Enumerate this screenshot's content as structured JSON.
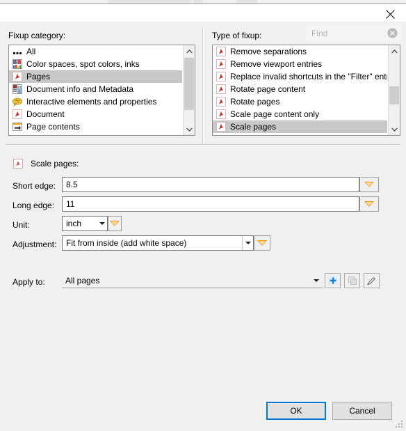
{
  "window": {
    "close_icon": "close-icon"
  },
  "left_pane": {
    "label": "Fixup category:",
    "items": [
      {
        "label": "All",
        "icon": "dots-icon",
        "selected": false
      },
      {
        "label": "Color spaces, spot colors, inks",
        "icon": "color-swatch-icon",
        "selected": false
      },
      {
        "label": "Pages",
        "icon": "pdf-icon",
        "selected": true
      },
      {
        "label": "Document info and Metadata",
        "icon": "metadata-info-icon",
        "selected": false
      },
      {
        "label": "Interactive elements and properties",
        "icon": "comment-bubble-icon",
        "selected": false
      },
      {
        "label": "Document",
        "icon": "pdf-icon",
        "selected": false
      },
      {
        "label": "Page contents",
        "icon": "arrow-page-icon",
        "selected": false
      }
    ],
    "scrollbar": {
      "up_icon": "chevron-up-icon",
      "down_icon": "chevron-down-icon"
    }
  },
  "right_pane": {
    "label": "Type of fixup:",
    "search": {
      "placeholder": "Find",
      "value": "",
      "clear_icon": "clear-circle-icon"
    },
    "items": [
      {
        "label": "Remove separations",
        "icon": "pdf-icon",
        "selected": false
      },
      {
        "label": "Remove viewport entries",
        "icon": "pdf-icon",
        "selected": false
      },
      {
        "label": "Replace invalid shortcuts in the \"Filter\" entry",
        "icon": "pdf-icon",
        "selected": false
      },
      {
        "label": "Rotate page content",
        "icon": "pdf-icon",
        "selected": false
      },
      {
        "label": "Rotate pages",
        "icon": "pdf-icon",
        "selected": false
      },
      {
        "label": "Scale page content only",
        "icon": "pdf-icon",
        "selected": false
      },
      {
        "label": "Scale pages",
        "icon": "pdf-icon",
        "selected": true
      }
    ],
    "scrollbar": {
      "up_icon": "chevron-up-icon",
      "down_icon": "chevron-down-icon"
    }
  },
  "fixup_form": {
    "header": {
      "icon": "pdf-icon",
      "title": "Scale pages:"
    },
    "rows": {
      "short_edge": {
        "label": "Short edge:",
        "value": "8.5",
        "spinner_icon": "orange-triangle-down-icon"
      },
      "long_edge": {
        "label": "Long edge:",
        "value": "11",
        "spinner_icon": "orange-triangle-down-icon"
      },
      "unit": {
        "label": "Unit:",
        "value": "inch",
        "caret_icon": "chevron-down-icon",
        "spinner_icon": "orange-triangle-down-icon"
      },
      "adjustment": {
        "label": "Adjustment:",
        "value": "Fit from inside (add white space)",
        "caret_icon": "chevron-down-icon",
        "spinner_icon": "orange-triangle-down-icon"
      },
      "apply_to": {
        "label": "Apply to:",
        "value": "All pages",
        "caret_icon": "chevron-down-icon",
        "buttons": [
          {
            "name": "add-button",
            "icon": "plus-icon",
            "enabled": true
          },
          {
            "name": "duplicate-button",
            "icon": "copy-icon",
            "enabled": false
          },
          {
            "name": "edit-button",
            "icon": "pencil-icon",
            "enabled": true
          }
        ]
      }
    }
  },
  "footer": {
    "ok_label": "OK",
    "cancel_label": "Cancel"
  },
  "colors": {
    "dialog_bg": "#f0f0f0",
    "accent_blue": "#0078d7",
    "spinner_orange": "#f29415",
    "selection_gray": "#c8c8c8",
    "pdf_icon_red": "#c0392b"
  }
}
